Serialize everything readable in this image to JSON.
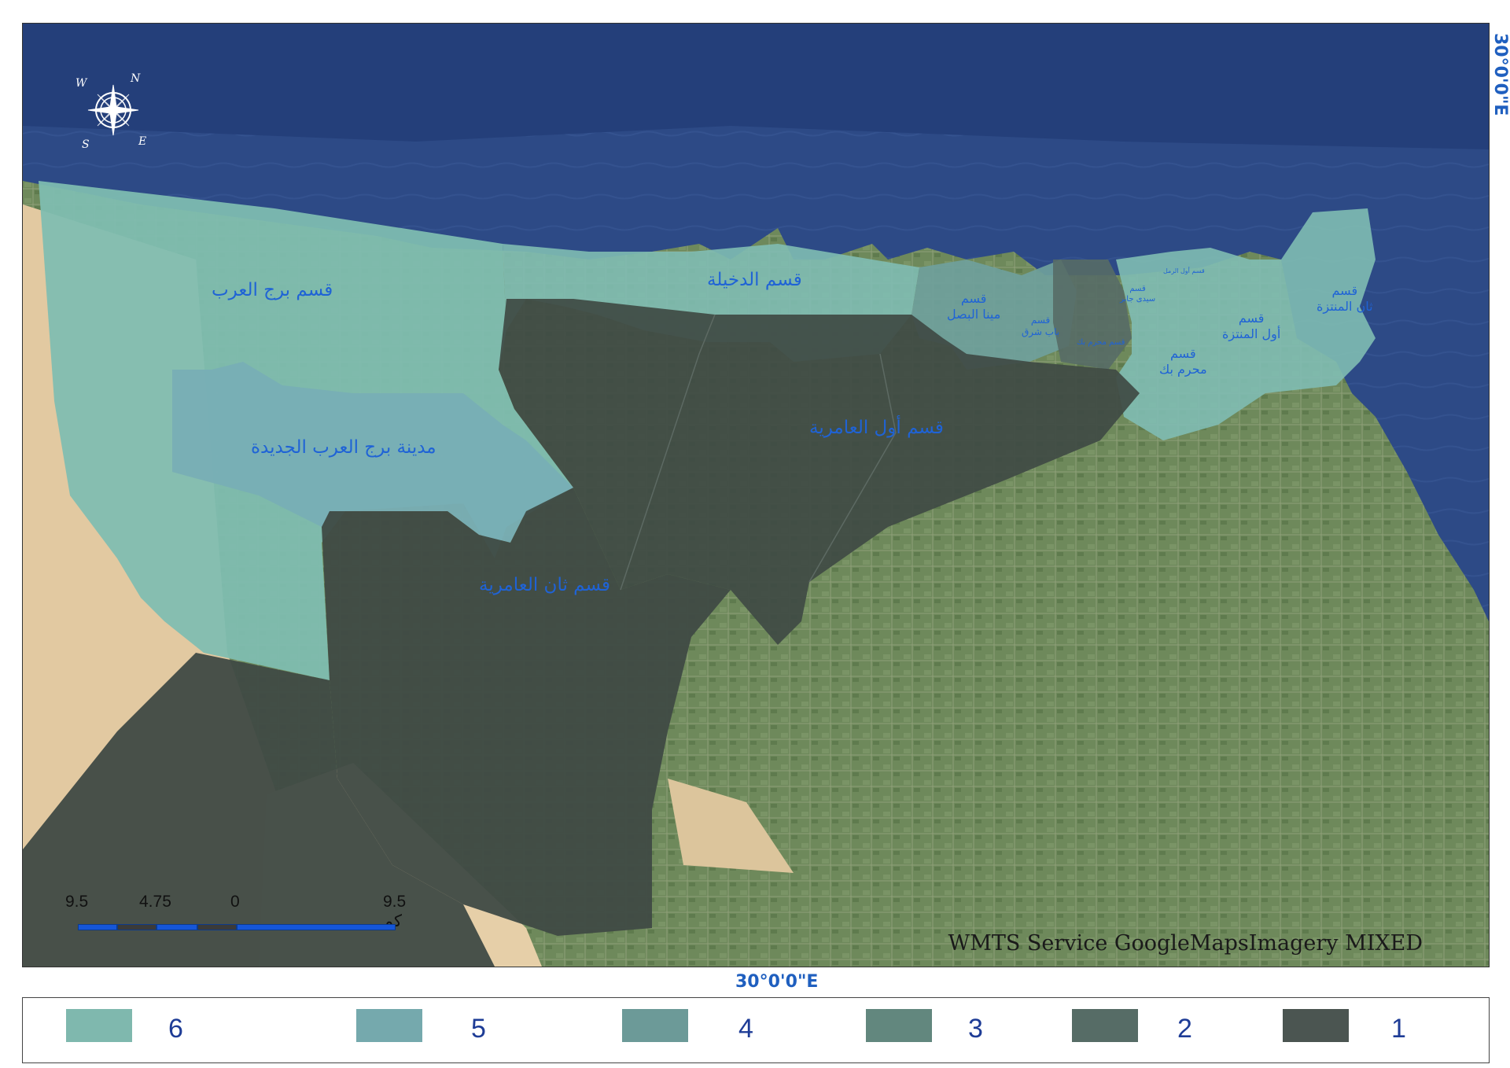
{
  "map": {
    "region_labels": [
      {
        "id": "burg-el-arab",
        "text": "قسم برج العرب",
        "size": 23
      },
      {
        "id": "new-burg-el-arab",
        "text": "مدينة برج العرب الجديدة",
        "size": 23
      },
      {
        "id": "dekheila",
        "text": "قسم الدخيلة",
        "size": 23
      },
      {
        "id": "first-amreya",
        "text": "قسم أول العامرية",
        "size": 23
      },
      {
        "id": "second-amreya",
        "text": "قسم ثان العامرية",
        "size": 23
      },
      {
        "id": "mina-el-basal",
        "text": "قسم\nمينا البصل",
        "size": 16
      },
      {
        "id": "bab-sharq",
        "text": "قسم\nباب شرق",
        "size": 12
      },
      {
        "id": "sidi-gaber",
        "text": "قسم\nسيدى جابر",
        "size": 10
      },
      {
        "id": "first-raml",
        "text": "قسم أول الرمل",
        "size": 8
      },
      {
        "id": "moharam-bek-small",
        "text": "قسم محرم بك",
        "size": 10
      },
      {
        "id": "moharam-bek",
        "text": "قسم\nمحرم بك",
        "size": 16
      },
      {
        "id": "first-montaza",
        "text": "قسم\nأول المنتزة",
        "size": 16
      },
      {
        "id": "second-montaza",
        "text": "قسم\nثان المنتزة",
        "size": 16
      }
    ],
    "attribution": "WMTS Service GoogleMapsImagery MIXED",
    "scale": {
      "ticks": [
        "9.5",
        "4.75",
        "0",
        "9.5 كم"
      ],
      "colors": [
        "#1556d8",
        "#3a3a3a",
        "#1556d8",
        "#3a3a3a",
        "#1556d8"
      ]
    },
    "compass": {
      "letters": [
        "N",
        "E",
        "S",
        "W"
      ],
      "icon": "compass-rose-icon"
    },
    "graticule": {
      "bottom": "30°0'0\"E",
      "right": "30°0'0\"E"
    }
  },
  "legend": [
    {
      "label": "6",
      "color": "#7fb8ae"
    },
    {
      "label": "5",
      "color": "#75a9ad"
    },
    {
      "label": "4",
      "color": "#6c9a98"
    },
    {
      "label": "3",
      "color": "#62877e"
    },
    {
      "label": "2",
      "color": "#566c66"
    },
    {
      "label": "1",
      "color": "#4b5551"
    }
  ],
  "colors": {
    "sea": "#2d4a86",
    "sea_deep": "#243f7a",
    "desert": "#e2c9a1",
    "farmland": "#6f8a5c",
    "class_6": "#7fbdb2",
    "class_5": "#78aeb5",
    "class_4": "#6f9f9c",
    "class_1": "#3f4a44",
    "label_text": "#1f63d6",
    "coord_text": "#1f5fbf"
  }
}
